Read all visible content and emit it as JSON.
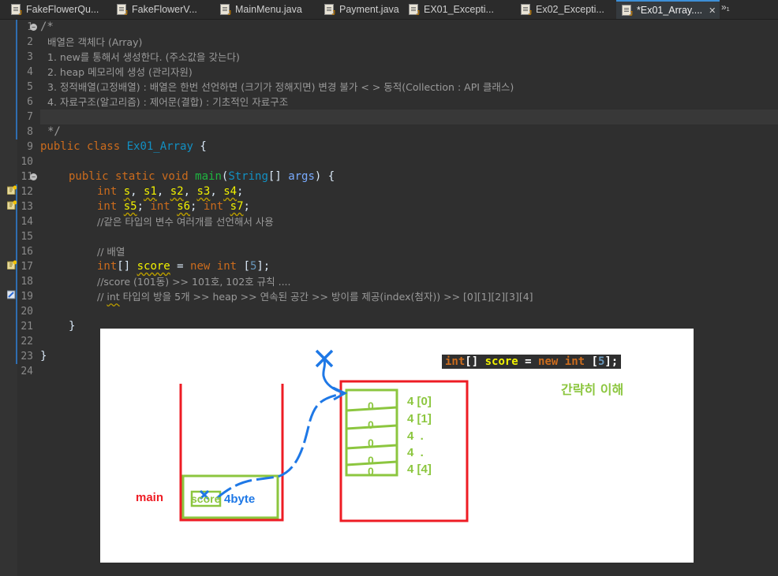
{
  "tabs": [
    {
      "label": "FakeFlowerQu..."
    },
    {
      "label": "FakeFlowerV..."
    },
    {
      "label": "MainMenu.java"
    },
    {
      "label": "Payment.java"
    },
    {
      "label": "EX01_Excepti..."
    },
    {
      "label": "Ex02_Excepti..."
    },
    {
      "label": "*Ex01_Array....",
      "close": "✕"
    }
  ],
  "tabs_overflow": "»₁",
  "line_numbers": [
    "1",
    "2",
    "3",
    "4",
    "5",
    "6",
    "7",
    "8",
    "9",
    "10",
    "11",
    "12",
    "13",
    "14",
    "15",
    "16",
    "17",
    "18",
    "19",
    "20",
    "21",
    "22",
    "23",
    "24"
  ],
  "code": {
    "l1": "/*",
    "l2": "배열은 객체다 (Array)",
    "l3": "1. new를 통해서 생성한다. (주소값을 갖는다)",
    "l4": "2. heap 메모리에 생성 (관리자원)",
    "l5": "3. 정적배열(고정배열) : 배열은 한번 선언하면 (크기가 정해지면) 변경 불가 < > 동적(Collection : API 클래스)",
    "l6": "4. 자료구조(알고리즘) : 제어문(결합) : 기초적인 자료구조",
    "l8": "*/",
    "l9": {
      "kw": "public class",
      "name": "Ex01_Array",
      "rest": " {"
    },
    "l11": {
      "kw": "public static void",
      "method": "main",
      "open": "(",
      "type": "String",
      "arr": "[] ",
      "param": "args",
      "close": ") {"
    },
    "l12": {
      "type": "int",
      "vars": [
        "s",
        "s1",
        "s2",
        "s3",
        "s4"
      ]
    },
    "l13": {
      "type": "int",
      "a": "s5",
      "b": "s6",
      "c": "s7"
    },
    "l14": "//같은 타입의 변수 여러개를 선언해서 사용",
    "l16": "// 배열",
    "l17": {
      "type": "int",
      "arr": "[] ",
      "var": "score",
      "eq": " = ",
      "new": "new",
      "type2": "int",
      "rest1": " [",
      "num": "5",
      "rest2": "];"
    },
    "l18": "//score (101동) >> 101호, 102호 규칙 ....",
    "l19": {
      "pre": "// ",
      "int": "int",
      "rest": " 타입의 방을 5개 >> heap >> 연속된 공간 >> 방이를 제공(index(첨자)) >> [0][1][2][3][4]"
    },
    "l21": "}",
    "l23": "}"
  },
  "diagram": {
    "snippet": {
      "type": "int",
      "arr": "[] ",
      "var": "score",
      "eq": " = ",
      "new": "new",
      "type2": "int",
      "rest1": " [",
      "num": "5",
      "rest2": "];"
    },
    "note": "간략히 이해",
    "main_label": "main",
    "score_label": "score",
    "size_label": "4byte",
    "cells": [
      {
        "value": "0",
        "label": "4 [0]"
      },
      {
        "value": "0",
        "label": "4 [1]"
      },
      {
        "value": "0",
        "label": "4  ."
      },
      {
        "value": "0",
        "label": "4  ."
      },
      {
        "value": "0",
        "label": "4 [4]"
      }
    ],
    "colors": {
      "stack": "#ee1c24",
      "heap": "#ee1c24",
      "cells": "#8cc63f",
      "arrow": "#1e78e6"
    }
  }
}
